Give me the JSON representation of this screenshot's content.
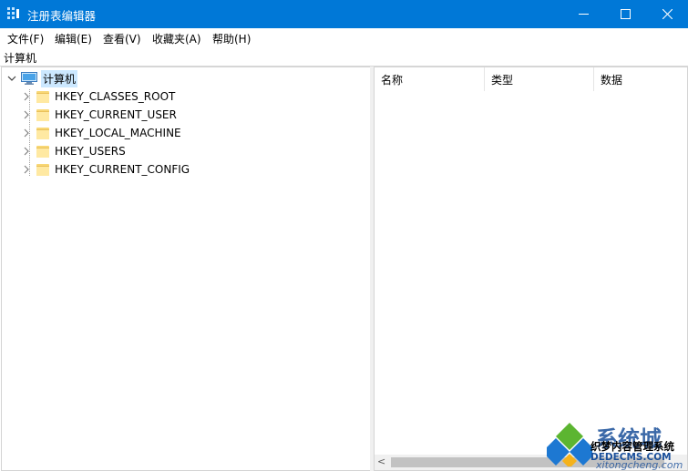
{
  "window": {
    "title": "注册表编辑器",
    "accent_color": "#0078d7",
    "controls": [
      "minimize-icon",
      "maximize-icon",
      "close-icon"
    ]
  },
  "menu": {
    "items": [
      {
        "label": "文件(F)"
      },
      {
        "label": "编辑(E)"
      },
      {
        "label": "查看(V)"
      },
      {
        "label": "收藏夹(A)"
      },
      {
        "label": "帮助(H)"
      }
    ]
  },
  "address": {
    "path": "计算机"
  },
  "tree": {
    "root": {
      "label": "计算机",
      "icon": "computer-icon",
      "expanded": true
    },
    "keys": [
      {
        "label": "HKEY_CLASSES_ROOT",
        "icon": "folder-icon"
      },
      {
        "label": "HKEY_CURRENT_USER",
        "icon": "folder-icon"
      },
      {
        "label": "HKEY_LOCAL_MACHINE",
        "icon": "folder-icon"
      },
      {
        "label": "HKEY_USERS",
        "icon": "folder-icon"
      },
      {
        "label": "HKEY_CURRENT_CONFIG",
        "icon": "folder-icon"
      }
    ]
  },
  "list": {
    "columns": [
      {
        "label": "名称"
      },
      {
        "label": "类型"
      },
      {
        "label": "数据"
      }
    ]
  },
  "watermark": {
    "line1": "系统城",
    "line2": "织梦内容管理系统",
    "line3": "DEDECMS.COM",
    "line4": "xitongcheng.com"
  }
}
